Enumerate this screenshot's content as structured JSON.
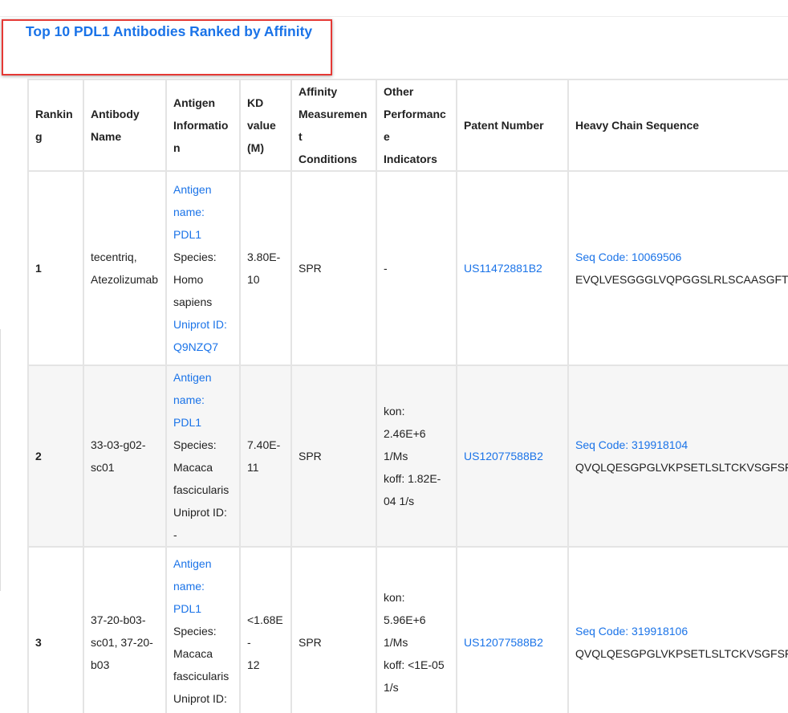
{
  "title": "Top 10 PDL1 Antibodies Ranked by Affinity",
  "columns": [
    [
      "Ranking"
    ],
    [
      "Antibody",
      "Name"
    ],
    [
      "Antigen",
      "Information"
    ],
    [
      "KD",
      "value",
      "(M)"
    ],
    [
      "Affinity",
      "Measurement",
      "Conditions"
    ],
    [
      "Other",
      "Performance",
      "Indicators"
    ],
    [
      "Patent Number"
    ],
    [
      "Heavy Chain Sequence"
    ]
  ],
  "rows": [
    {
      "ranking": "1",
      "name": [
        "tecentriq,",
        "Atezolizumab"
      ],
      "antigen": {
        "name": [
          "Antigen",
          "name:",
          "PDL1"
        ],
        "species": [
          "Species:",
          "Homo",
          "sapiens"
        ],
        "uniprot": [
          "Uniprot ID:",
          "Q9NZQ7"
        ],
        "uniprot_link": true
      },
      "kd": [
        "3.80E-",
        "10"
      ],
      "conditions": "SPR",
      "other": [
        "-"
      ],
      "patent": "US11472881B2",
      "seq_code": "Seq Code: 10069506",
      "sequence": "EVQLVESGGGLVQPGGSLRLSCAASGFTFSDSWIHWVRQAPGKGLEWVAWISPYGGSTYYADSVKG"
    },
    {
      "ranking": "2",
      "name": [
        "33-03-g02-",
        "sc01"
      ],
      "antigen": {
        "name": [
          "Antigen",
          "name:",
          "PDL1"
        ],
        "species": [
          "Species:",
          "Macaca",
          "fascicularis"
        ],
        "uniprot": [
          "Uniprot ID: -"
        ],
        "uniprot_link": false
      },
      "kd": [
        "7.40E-",
        "11"
      ],
      "conditions": "SPR",
      "other": [
        "kon: 2.46E+6",
        "1/Ms",
        "koff: 1.82E-",
        "04 1/s"
      ],
      "patent": "US12077588B2",
      "seq_code": "Seq Code: 319918104",
      "sequence": "QVQLQESGPGLVKPSETLSLTCKVSGFSFSSGYYWGWIRQPPGKGLEWIGSIYHSGSTYYNPSLKS"
    },
    {
      "ranking": "3",
      "name": [
        "37-20-b03-",
        "sc01, 37-20-",
        "b03"
      ],
      "antigen": {
        "name": [
          "Antigen",
          "name:",
          "PDL1"
        ],
        "species": [
          "Species:",
          "Macaca",
          "fascicularis"
        ],
        "uniprot": [
          "Uniprot ID: -"
        ],
        "uniprot_link": false
      },
      "kd": [
        "<1.68E-",
        "12"
      ],
      "conditions": "SPR",
      "other": [
        "kon: 5.96E+6",
        "1/Ms",
        "koff: <1E-05",
        "1/s"
      ],
      "patent": "US12077588B2",
      "seq_code": "Seq Code: 319918106",
      "sequence": "QVQLQESGPGLVKPSETLSLTCKVSGFSFNSGYYWGWIRQPPGKGLEWIGSIYHSGSTYYNPSLKS"
    }
  ]
}
